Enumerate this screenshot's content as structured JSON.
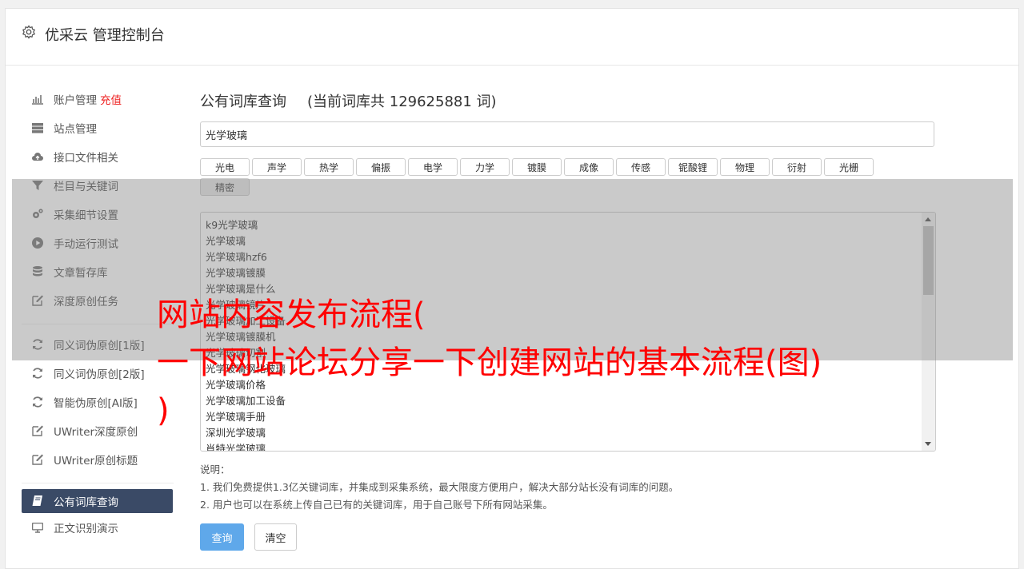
{
  "header": {
    "title": "优采云 管理控制台",
    "icon": "gear-icon"
  },
  "sidebar": {
    "group1": [
      {
        "label": "账户管理",
        "badge": "充值",
        "icon": "bar-chart-icon"
      },
      {
        "label": "站点管理",
        "icon": "server-icon"
      },
      {
        "label": "接口文件相关",
        "icon": "cloud-upload-icon"
      },
      {
        "label": "栏目与关键词",
        "icon": "filter-icon"
      },
      {
        "label": "采集细节设置",
        "icon": "gears-icon"
      },
      {
        "label": "手动运行测试",
        "icon": "play-circle-icon"
      },
      {
        "label": "文章暂存库",
        "icon": "database-icon"
      },
      {
        "label": "深度原创任务",
        "icon": "edit-icon"
      }
    ],
    "group2": [
      {
        "label": "同义词伪原创[1版]",
        "icon": "refresh-icon"
      },
      {
        "label": "同义词伪原创[2版]",
        "icon": "refresh-icon"
      },
      {
        "label": "智能伪原创[AI版]",
        "icon": "refresh-icon"
      },
      {
        "label": "UWriter深度原创",
        "icon": "edit-icon"
      },
      {
        "label": "UWriter原创标题",
        "icon": "edit-icon"
      }
    ],
    "group3": [
      {
        "label": "公有词库查询",
        "icon": "book-icon",
        "active": true
      },
      {
        "label": "正文识别演示",
        "icon": "monitor-icon"
      }
    ]
  },
  "main": {
    "title": "公有词库查询",
    "count_text": "(当前词库共 129625881 词)",
    "search_value": "光学玻璃",
    "tags": [
      "光电",
      "声学",
      "热学",
      "偏振",
      "电学",
      "力学",
      "镀膜",
      "成像",
      "传感",
      "铌酸锂",
      "物理",
      "衍射",
      "光栅",
      "精密"
    ],
    "results": [
      "k9光学玻璃",
      "光学玻璃",
      "光学玻璃hzf6",
      "光学玻璃镀膜",
      "光学玻璃是什么",
      "光学玻璃镜片",
      "光学玻璃加工设备",
      "光学玻璃镀膜机",
      "光学玻璃切割",
      "光学玻璃钢化玻璃",
      "光学玻璃价格",
      "光学玻璃加工设备",
      "光学玻璃手册",
      "深圳光学玻璃",
      "肖特光学玻璃"
    ],
    "notes_title": "说明：",
    "notes": [
      "1. 我们免费提供1.3亿关键词库，并集成到采集系统，最大限度方便用户，解决大部分站长没有词库的问题。",
      "2. 用户也可以在系统上传自己已有的关键词库，用于自己账号下所有网站采集。"
    ],
    "query_button": "查询",
    "clear_button": "清空"
  },
  "overlay": {
    "line1": "网站内容发布流程(",
    "line2": "一下网站论坛分享一下创建网站的基本流程(图)",
    "line3": ")",
    "text_color": "#ff0000"
  }
}
